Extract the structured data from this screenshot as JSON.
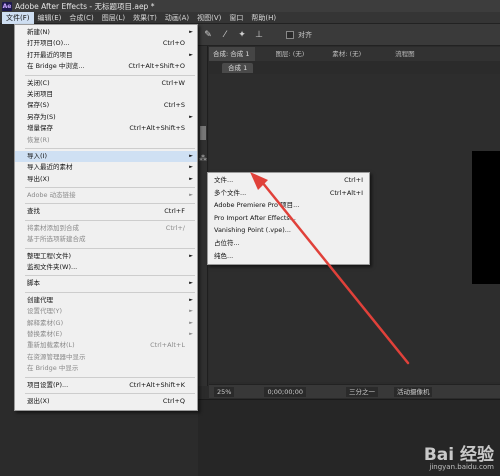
{
  "app": {
    "logo": "Ae",
    "title": "Adobe After Effects - 无标题项目.aep *"
  },
  "menubar": [
    "文件(F)",
    "编辑(E)",
    "合成(C)",
    "图层(L)",
    "效果(T)",
    "动画(A)",
    "视图(V)",
    "窗口",
    "帮助(H)"
  ],
  "toolbar": {
    "align_label": "对齐"
  },
  "comp_panel": {
    "tab_comp": "合成: 合成 1",
    "tab_layer": "图层: (无)",
    "tab_footage": "素材: (无)",
    "tab_flow": "流程图",
    "sub_tab": "合成 1",
    "zoom": "25%",
    "timecode": "0;00;00;00",
    "resolution": "三分之一",
    "camera": "活动摄像机"
  },
  "file_menu": [
    {
      "label": "新建(N)",
      "shortcut": "",
      "arrow": true,
      "disabled": false
    },
    {
      "label": "打开项目(O)...",
      "shortcut": "Ctrl+O",
      "arrow": false,
      "disabled": false
    },
    {
      "label": "打开最近的项目",
      "shortcut": "",
      "arrow": true,
      "disabled": false
    },
    {
      "label": "在 Bridge 中浏览...",
      "shortcut": "Ctrl+Alt+Shift+O",
      "arrow": false,
      "disabled": false
    },
    {
      "sep": true
    },
    {
      "label": "关闭(C)",
      "shortcut": "Ctrl+W",
      "arrow": false,
      "disabled": false
    },
    {
      "label": "关闭项目",
      "shortcut": "",
      "arrow": false,
      "disabled": false
    },
    {
      "label": "保存(S)",
      "shortcut": "Ctrl+S",
      "arrow": false,
      "disabled": false
    },
    {
      "label": "另存为(S)",
      "shortcut": "",
      "arrow": true,
      "disabled": false
    },
    {
      "label": "增量保存",
      "shortcut": "Ctrl+Alt+Shift+S",
      "arrow": false,
      "disabled": false
    },
    {
      "label": "恢复(R)",
      "shortcut": "",
      "arrow": false,
      "disabled": true
    },
    {
      "sep": true
    },
    {
      "label": "导入(I)",
      "shortcut": "",
      "arrow": true,
      "disabled": false,
      "highlight": true
    },
    {
      "label": "导入最近的素材",
      "shortcut": "",
      "arrow": true,
      "disabled": false
    },
    {
      "label": "导出(X)",
      "shortcut": "",
      "arrow": true,
      "disabled": false
    },
    {
      "sep": true
    },
    {
      "label": "Adobe 动态链接",
      "shortcut": "",
      "arrow": true,
      "disabled": true
    },
    {
      "sep": true
    },
    {
      "label": "查找",
      "shortcut": "Ctrl+F",
      "arrow": false,
      "disabled": false
    },
    {
      "sep": true
    },
    {
      "label": "将素材添加到合成",
      "shortcut": "Ctrl+/",
      "arrow": false,
      "disabled": true
    },
    {
      "label": "基于所选项新建合成",
      "shortcut": "",
      "arrow": false,
      "disabled": true
    },
    {
      "sep": true
    },
    {
      "label": "整理工程(文件)",
      "shortcut": "",
      "arrow": true,
      "disabled": false
    },
    {
      "label": "监视文件夹(W)...",
      "shortcut": "",
      "arrow": false,
      "disabled": false
    },
    {
      "sep": true
    },
    {
      "label": "脚本",
      "shortcut": "",
      "arrow": true,
      "disabled": false
    },
    {
      "sep": true
    },
    {
      "label": "创建代理",
      "shortcut": "",
      "arrow": true,
      "disabled": false
    },
    {
      "label": "设置代理(Y)",
      "shortcut": "",
      "arrow": true,
      "disabled": true
    },
    {
      "label": "解释素材(G)",
      "shortcut": "",
      "arrow": true,
      "disabled": true
    },
    {
      "label": "替换素材(E)",
      "shortcut": "",
      "arrow": true,
      "disabled": true
    },
    {
      "label": "重新加载素材(L)",
      "shortcut": "Ctrl+Alt+L",
      "arrow": false,
      "disabled": true
    },
    {
      "label": "在资源管理器中显示",
      "shortcut": "",
      "arrow": false,
      "disabled": true
    },
    {
      "label": "在 Bridge 中显示",
      "shortcut": "",
      "arrow": false,
      "disabled": true
    },
    {
      "sep": true
    },
    {
      "label": "项目设置(P)...",
      "shortcut": "Ctrl+Alt+Shift+K",
      "arrow": false,
      "disabled": false
    },
    {
      "sep": true
    },
    {
      "label": "退出(X)",
      "shortcut": "Ctrl+Q",
      "arrow": false,
      "disabled": false
    }
  ],
  "import_submenu": [
    {
      "label": "文件...",
      "shortcut": "Ctrl+I"
    },
    {
      "label": "多个文件...",
      "shortcut": "Ctrl+Alt+I"
    },
    {
      "label": "Adobe Premiere Pro 项目...",
      "shortcut": ""
    },
    {
      "label": "Pro Import After Effects...",
      "shortcut": ""
    },
    {
      "label": "Vanishing Point (.vpe)...",
      "shortcut": ""
    },
    {
      "label": "占位符...",
      "shortcut": ""
    },
    {
      "label": "纯色...",
      "shortcut": ""
    }
  ],
  "annotation": {
    "color": "#e0413a"
  },
  "watermark": {
    "main": "Bai 经验",
    "sub": "jingyan.baidu.com"
  }
}
